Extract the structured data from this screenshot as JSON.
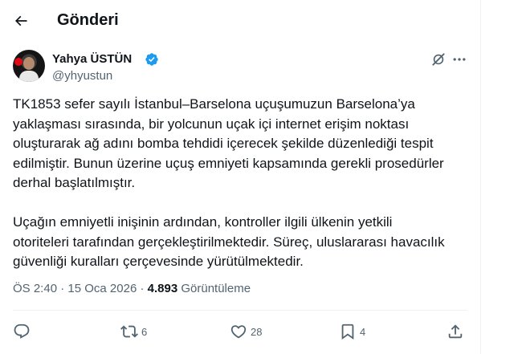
{
  "header": {
    "title": "Gönderi"
  },
  "author": {
    "name": "Yahya ÜSTÜN",
    "handle": "@yhyustun"
  },
  "tweet": {
    "paragraph1": "TK1853 sefer sayılı İstanbul–Barselona uçuşumuzun Barselona’ya\nyaklaşması sırasında, bir yolcunun uçak içi internet erişim noktası\noluşturarak ağ adını bomba tehdidi içerecek şekilde düzenlediği tespit\nedilmiştir. Bunun üzerine uçuş emniyeti kapsamında gerekli prosedürler\nderhal başlatılmıştır.",
    "paragraph2": "Uçağın emniyetli inişinin ardından, kontroller ilgili ülkenin yetkili\notoriteleri tarafından gerçekleştirilmektedir. Süreç, uluslararası havacılık\ngüvenliği kuralları çerçevesinde yürütülmektedir."
  },
  "meta": {
    "time": "ÖS 2:40",
    "separator": " · ",
    "date": "15 Oca 2026",
    "separator2": " · ",
    "views_count": "4.893",
    "views_label": " Görüntüleme"
  },
  "actions": {
    "retweet_count": "6",
    "like_count": "28",
    "bookmark_count": "4"
  },
  "colors": {
    "verified": "#1d9bf0",
    "secondary_text": "#536471",
    "primary_text": "#0f1419"
  },
  "icons": [
    "back-arrow-icon",
    "verified-badge-icon",
    "grok-icon",
    "more-icon",
    "reply-icon",
    "retweet-icon",
    "like-icon",
    "bookmark-icon",
    "share-icon"
  ]
}
